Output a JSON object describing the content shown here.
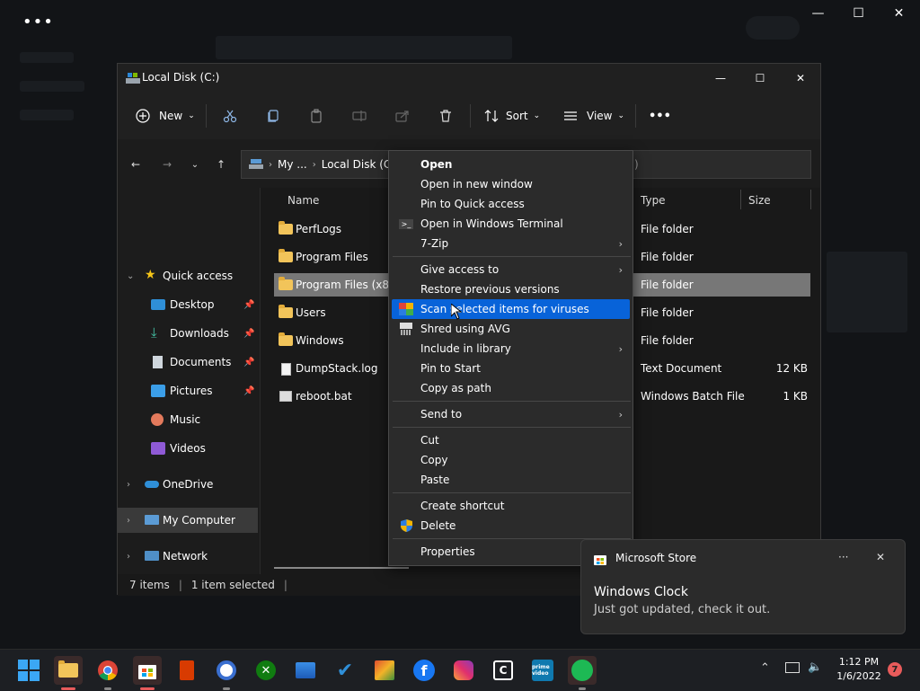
{
  "background": {
    "menu_dots": "•••"
  },
  "window": {
    "title": "Local Disk (C:)",
    "minimize": "—",
    "maximize": "☐",
    "close": "✕"
  },
  "toolbar": {
    "new_label": "New",
    "sort_label": "Sort",
    "view_label": "View",
    "more_label": "•••"
  },
  "address": {
    "segments": [
      "My ...",
      "Local Disk (C"
    ],
    "search_placeholder": ":)"
  },
  "navpane": {
    "quick_access": "Quick access",
    "items": [
      {
        "label": "Desktop",
        "icon": "desktop-icon"
      },
      {
        "label": "Downloads",
        "icon": "downloads-icon"
      },
      {
        "label": "Documents",
        "icon": "documents-icon"
      },
      {
        "label": "Pictures",
        "icon": "pictures-icon"
      },
      {
        "label": "Music",
        "icon": "music-icon"
      },
      {
        "label": "Videos",
        "icon": "videos-icon"
      }
    ],
    "onedrive": "OneDrive",
    "my_computer": "My Computer",
    "network": "Network"
  },
  "columns": {
    "name": "Name",
    "type": "Type",
    "size": "Size"
  },
  "files": [
    {
      "name": "PerfLogs",
      "type": "File folder",
      "size": "",
      "kind": "folder"
    },
    {
      "name": "Program Files",
      "type": "File folder",
      "size": "",
      "kind": "folder"
    },
    {
      "name": "Program Files (x86)",
      "type": "File folder",
      "size": "",
      "kind": "folder",
      "selected": true
    },
    {
      "name": "Users",
      "type": "File folder",
      "size": "",
      "kind": "folder"
    },
    {
      "name": "Windows",
      "type": "File folder",
      "size": "",
      "kind": "folder"
    },
    {
      "name": "DumpStack.log",
      "type": "Text Document",
      "size": "12 KB",
      "kind": "doc"
    },
    {
      "name": "reboot.bat",
      "type": "Windows Batch File",
      "size": "1 KB",
      "kind": "bat"
    }
  ],
  "status": {
    "count": "7 items",
    "selected": "1 item selected"
  },
  "context_menu": {
    "open": "Open",
    "open_new_window": "Open in new window",
    "pin_quick_access": "Pin to Quick access",
    "open_terminal": "Open in Windows Terminal",
    "seven_zip": "7-Zip",
    "give_access": "Give access to",
    "restore_versions": "Restore previous versions",
    "scan_viruses": "Scan selected items for viruses",
    "shred_avg": "Shred using AVG",
    "include_library": "Include in library",
    "pin_start": "Pin to Start",
    "copy_path": "Copy as path",
    "send_to": "Send to",
    "cut": "Cut",
    "copy": "Copy",
    "paste": "Paste",
    "create_shortcut": "Create shortcut",
    "delete": "Delete",
    "properties": "Properties"
  },
  "toast": {
    "app": "Microsoft Store",
    "more": "···",
    "close": "✕",
    "title": "Windows Clock",
    "body": "Just got updated, check it out."
  },
  "taskbar": {
    "time": "1:12 PM",
    "date": "1/6/2022",
    "notification_count": "7"
  },
  "colors": {
    "accent": "#0863d9",
    "selected_row": "#777777",
    "folder": "#f2c45a",
    "badge": "#e85b5b"
  }
}
